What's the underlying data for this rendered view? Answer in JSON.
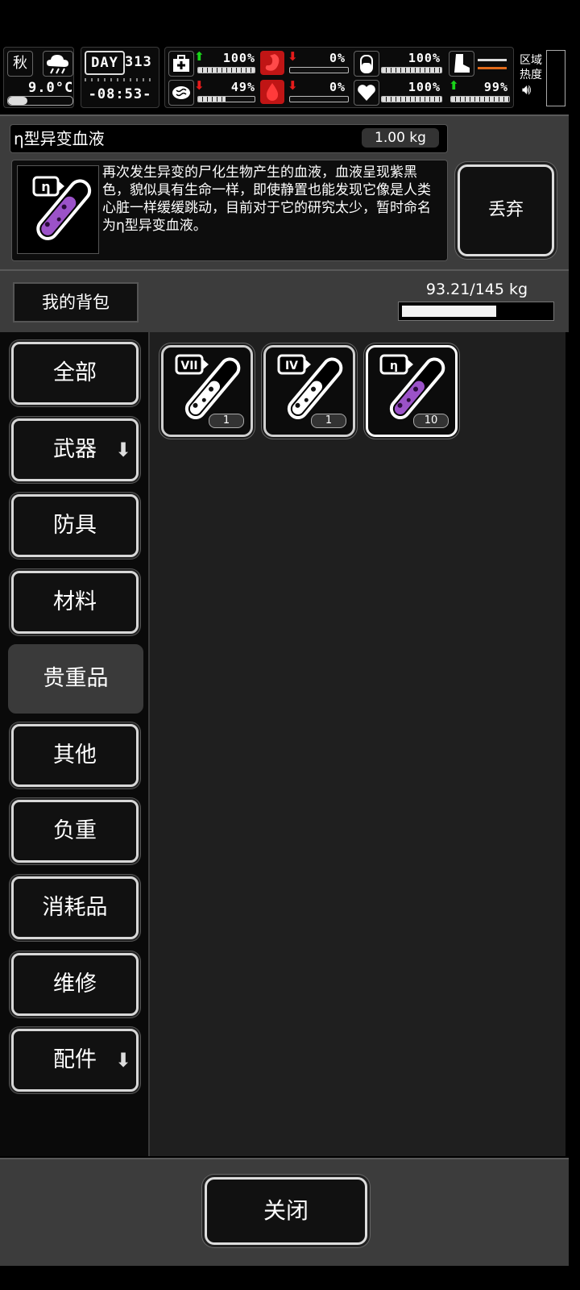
{
  "status": {
    "season": "秋",
    "weather_icon": "storm-cloud-icon",
    "temperature": "9.0°C",
    "day_label": "DAY",
    "day_number": "313",
    "time": "-08:53-",
    "medical": {
      "value": "100%",
      "trend": "up"
    },
    "hunger": {
      "value": "0%",
      "trend": "down"
    },
    "drink": {
      "value": "100%",
      "trend": "none"
    },
    "brain": {
      "value": "49%",
      "trend": "down"
    },
    "blood": {
      "value": "0%",
      "trend": "down"
    },
    "heart": {
      "value": "100%",
      "trend": "none"
    },
    "stamina": {
      "value": "99%",
      "trend": "up"
    },
    "area_heat_label_1": "区域",
    "area_heat_label_2": "热度",
    "sound_icon": "speaker-icon"
  },
  "item_detail": {
    "name": "η型异变血液",
    "weight": "1.00 kg",
    "icon_label": "η",
    "description": "再次发生异变的尸化生物产生的血液，血液呈现紫黑色，貌似具有生命一样，即使静置也能发现它像是人类心脏一样缓缓跳动，目前对于它的研究太少，暂时命名为η型异变血液。",
    "discard_label": "丢弃"
  },
  "bag": {
    "title": "我的背包",
    "capacity": "93.21/145 kg",
    "capacity_fraction": 0.643
  },
  "categories": [
    {
      "label": "全部",
      "dropdown": false,
      "selected": false
    },
    {
      "label": "武器",
      "dropdown": true,
      "selected": false
    },
    {
      "label": "防具",
      "dropdown": false,
      "selected": false
    },
    {
      "label": "材料",
      "dropdown": false,
      "selected": false
    },
    {
      "label": "贵重品",
      "dropdown": false,
      "selected": true
    },
    {
      "label": "其他",
      "dropdown": false,
      "selected": false
    },
    {
      "label": "负重",
      "dropdown": false,
      "selected": false
    },
    {
      "label": "消耗品",
      "dropdown": false,
      "selected": false
    },
    {
      "label": "维修",
      "dropdown": false,
      "selected": false
    },
    {
      "label": "配件",
      "dropdown": true,
      "selected": false
    }
  ],
  "items": [
    {
      "tag": "VII",
      "count": "1",
      "liquid": "white",
      "selected": false
    },
    {
      "tag": "IV",
      "count": "1",
      "liquid": "white",
      "selected": false
    },
    {
      "tag": "η",
      "count": "10",
      "liquid": "#9b52c8",
      "selected": true
    }
  ],
  "close_label": "关闭"
}
